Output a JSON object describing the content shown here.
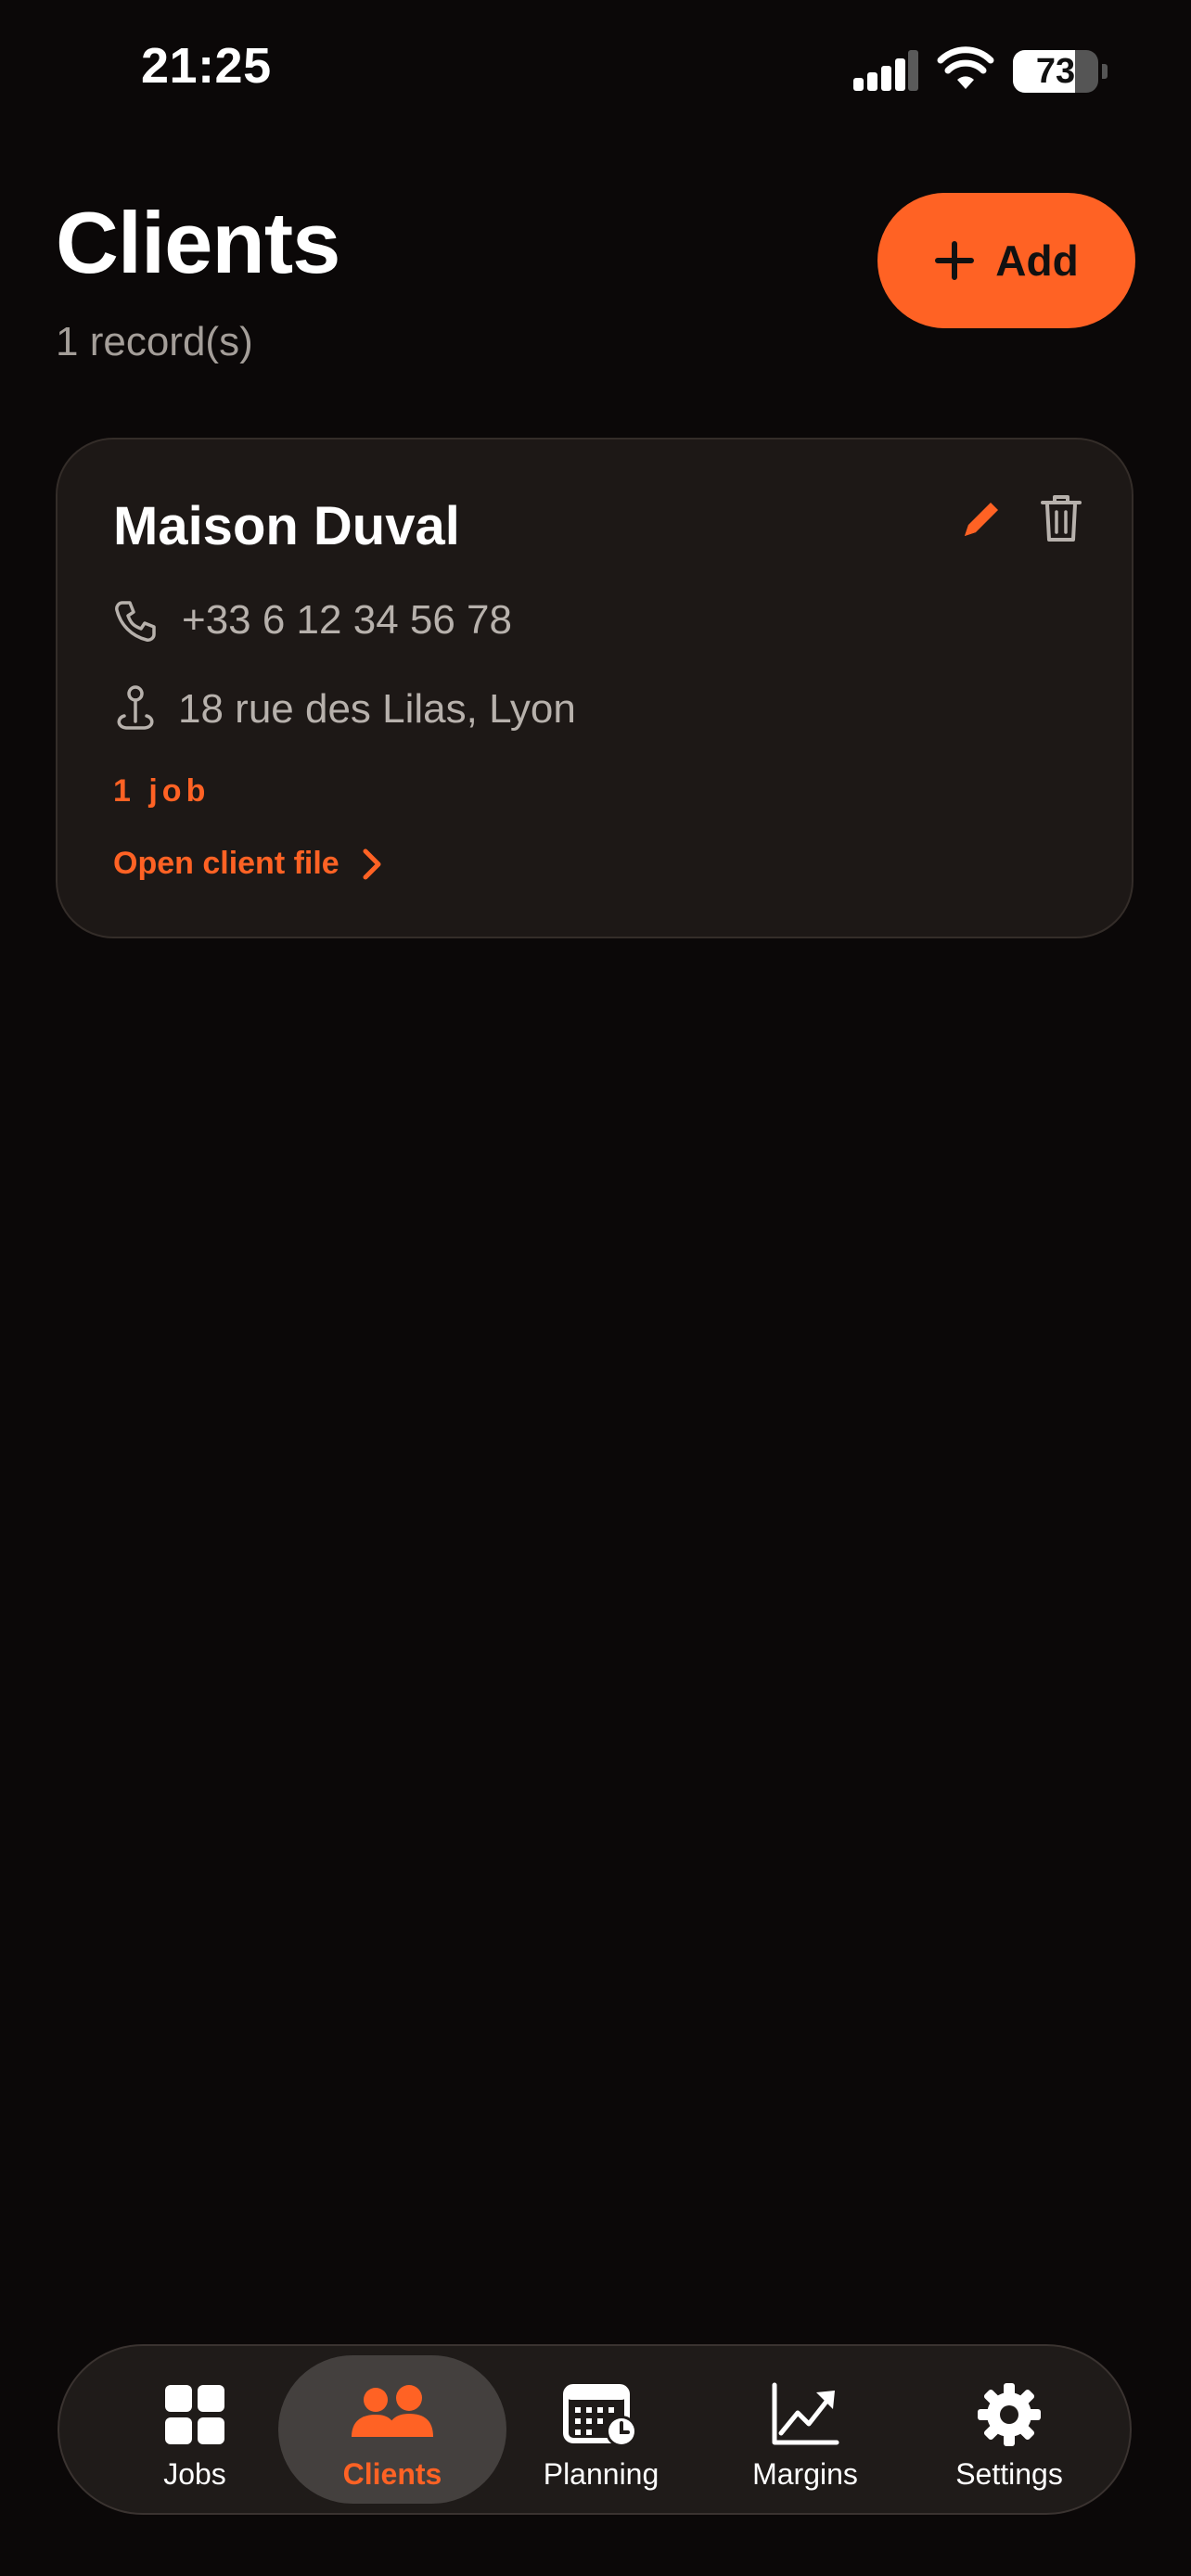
{
  "status_bar": {
    "time": "21:25",
    "battery_level": "73",
    "battery_fraction": 0.73,
    "icons": [
      "signal-icon",
      "wifi-icon",
      "battery-icon"
    ]
  },
  "header": {
    "title": "Clients",
    "subtitle": "1 record(s)",
    "add_label": "Add"
  },
  "client": {
    "name": "Maison Duval",
    "phone": "+33 6 12 34 56 78",
    "address": "18 rue des Lilas, Lyon",
    "jobs": "1 job",
    "open_label": "Open client file"
  },
  "tabs": [
    {
      "label": "Jobs",
      "icon": "grid-icon",
      "active": false
    },
    {
      "label": "Clients",
      "icon": "people-icon",
      "active": true
    },
    {
      "label": "Planning",
      "icon": "calendar-clock-icon",
      "active": false
    },
    {
      "label": "Margins",
      "icon": "trend-chart-icon",
      "active": false
    },
    {
      "label": "Settings",
      "icon": "gear-icon",
      "active": false
    }
  ],
  "colors": {
    "accent": "#ff6224",
    "background": "#0b0808",
    "card": "#1d1816",
    "muted_text": "#a49e99"
  }
}
